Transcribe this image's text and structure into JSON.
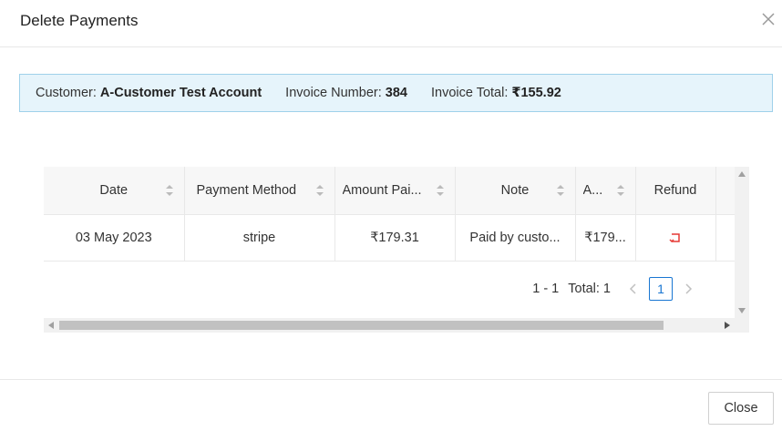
{
  "dialog": {
    "title": "Delete Payments",
    "close_button_label": "Close"
  },
  "info": {
    "customer_label": "Customer:",
    "customer_value": "A-Customer Test Account",
    "invoice_number_label": "Invoice Number:",
    "invoice_number_value": "384",
    "invoice_total_label": "Invoice Total:",
    "invoice_total_value": "₹155.92"
  },
  "table": {
    "columns": [
      "Date",
      "Payment Method",
      "Amount Pai...",
      "Note",
      "A...",
      "Refund"
    ],
    "rows": [
      {
        "date": "03 May 2023",
        "method": "stripe",
        "amount": "₹179.31",
        "note": "Paid by custo...",
        "a": "₹179..."
      }
    ]
  },
  "pagination": {
    "range": "1 - 1",
    "total": "Total: 1",
    "current_page": "1"
  },
  "icons": {
    "dialog_close": "close-icon",
    "sort": "sort-icon",
    "refund": "refund-icon",
    "prev": "chevron-left-icon",
    "next": "chevron-right-icon"
  },
  "colors": {
    "info_bg": "#e6f4fb",
    "info_border": "#9fd1ea",
    "accent": "#1976d2",
    "refund": "#e53935"
  }
}
